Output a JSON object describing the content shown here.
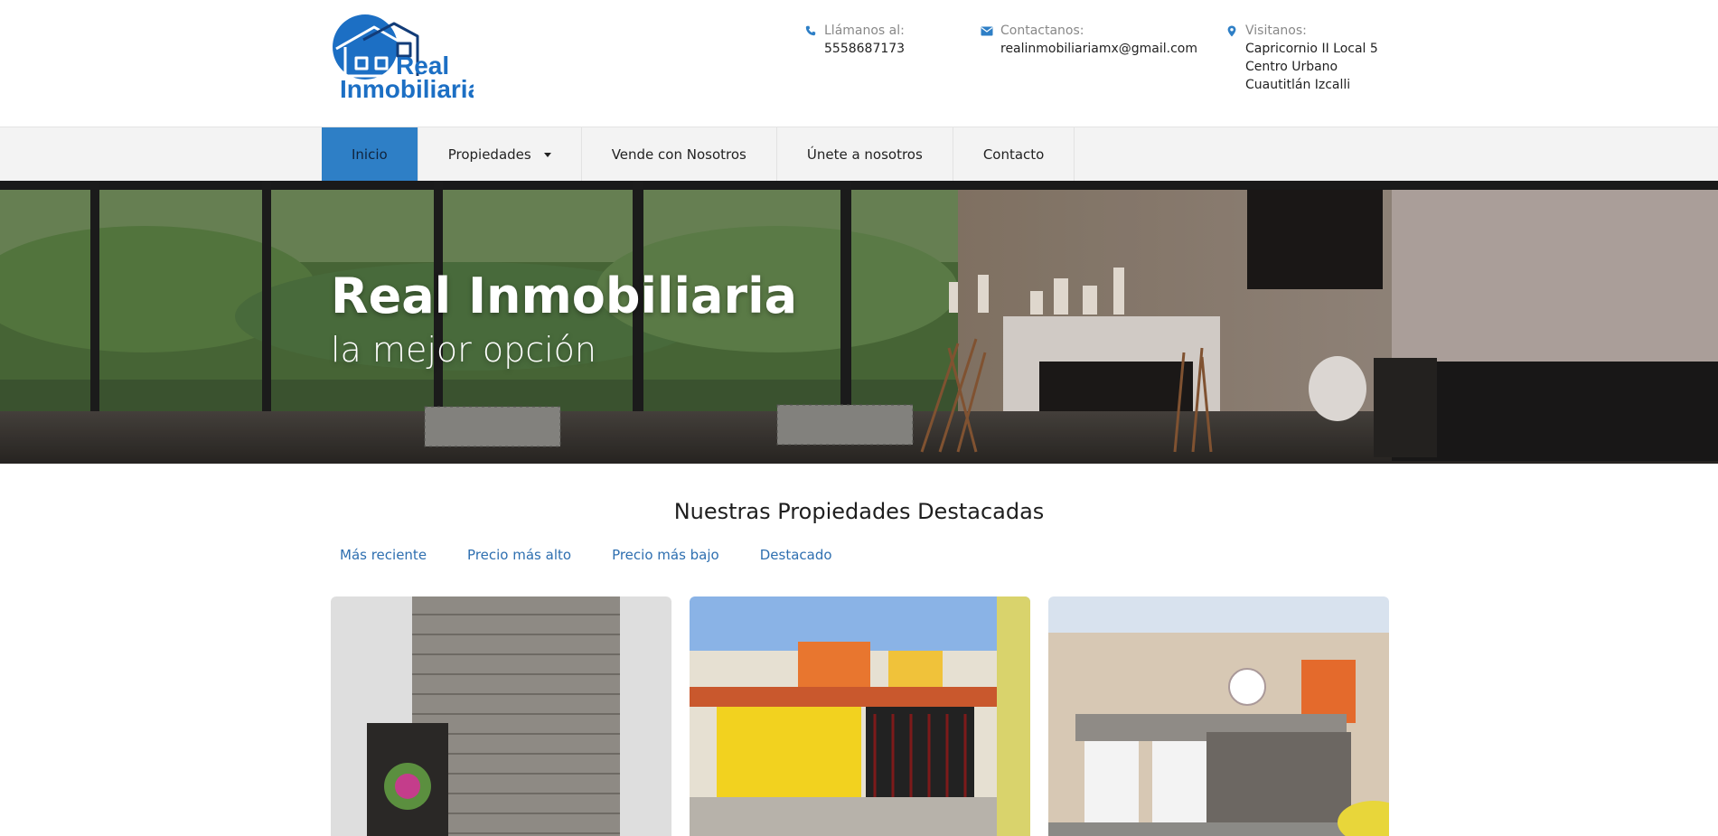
{
  "brand": {
    "logo_text_1": "Real",
    "logo_text_2": "Inmobiliaria",
    "brand_color": "#1c6fc4"
  },
  "contact": {
    "phone": {
      "icon": "phone-icon",
      "label": "Llámanos al:",
      "value": "5558687173"
    },
    "email": {
      "icon": "envelope-icon",
      "label": "Contactanos:",
      "value": "realinmobiliariamx@gmail.com"
    },
    "visit": {
      "icon": "map-marker-icon",
      "label": "Visitanos:",
      "lines": [
        "Capricornio II Local 5",
        "Centro Urbano",
        "Cuautitlán Izcalli"
      ]
    }
  },
  "nav": {
    "items": [
      {
        "label": "Inicio",
        "active": true
      },
      {
        "label": "Propiedades",
        "dropdown": true
      },
      {
        "label": "Vende con Nosotros"
      },
      {
        "label": "Únete a nosotros"
      },
      {
        "label": "Contacto"
      }
    ],
    "accent": "#2e7fc6"
  },
  "hero": {
    "title": "Real Inmobiliaria",
    "subtitle": "la mejor opción"
  },
  "featured": {
    "title": "Nuestras Propiedades Destacadas",
    "filters": [
      "Más reciente",
      "Precio más alto",
      "Precio más bajo",
      "Destacado"
    ]
  }
}
